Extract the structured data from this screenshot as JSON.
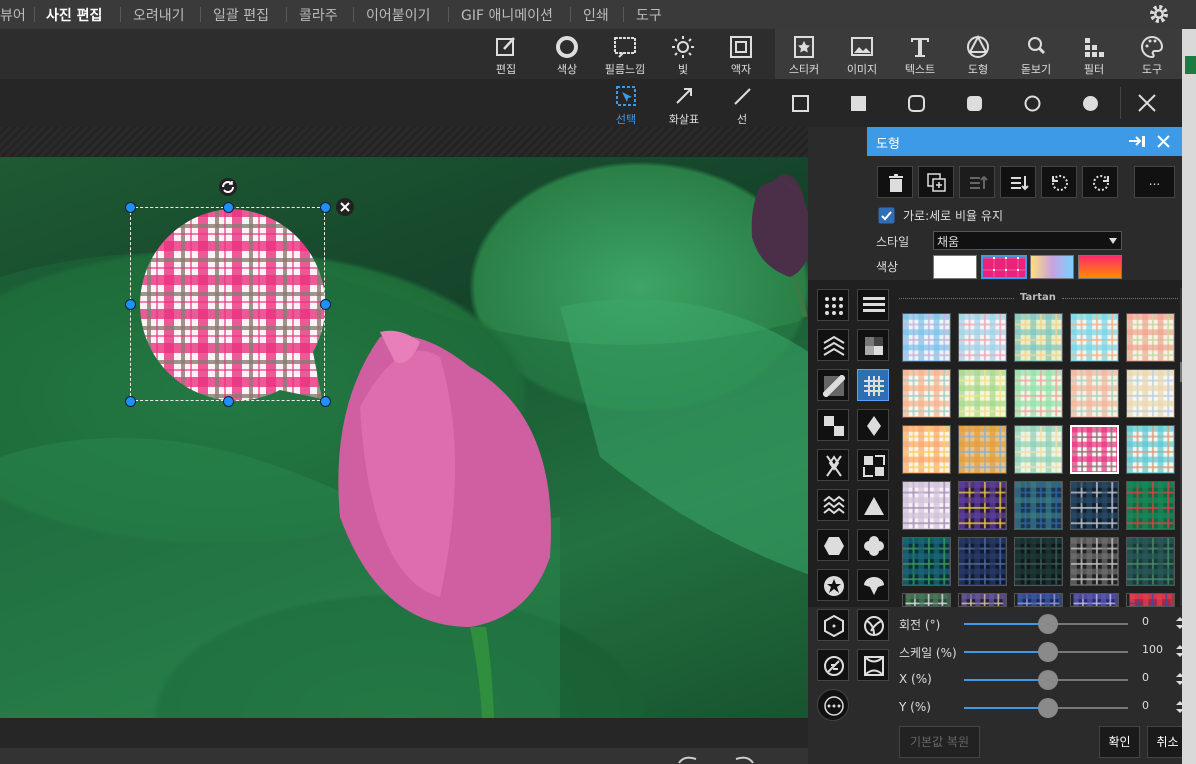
{
  "menu": {
    "items": [
      {
        "label": "뷰어",
        "active": false
      },
      {
        "label": "사진 편집",
        "active": true
      },
      {
        "label": "오려내기",
        "active": false
      },
      {
        "label": "일괄 편집",
        "active": false
      },
      {
        "label": "콜라주",
        "active": false
      },
      {
        "label": "이어붙이기",
        "active": false
      },
      {
        "label": "GIF 애니메이션",
        "active": false
      },
      {
        "label": "인쇄",
        "active": false
      },
      {
        "label": "도구",
        "active": false
      }
    ]
  },
  "toolbar": {
    "left_tools": [
      {
        "label": "편집",
        "icon": "edit-icon"
      },
      {
        "label": "색상",
        "icon": "color-ring-icon"
      },
      {
        "label": "필름느낌",
        "icon": "film-icon"
      },
      {
        "label": "빛",
        "icon": "sun-icon"
      },
      {
        "label": "액자",
        "icon": "frame-icon"
      }
    ],
    "right_tools": [
      {
        "label": "스티커",
        "icon": "sticker-icon"
      },
      {
        "label": "이미지",
        "icon": "image-icon"
      },
      {
        "label": "텍스트",
        "icon": "text-icon"
      },
      {
        "label": "도형",
        "icon": "shape-icon"
      },
      {
        "label": "돋보기",
        "icon": "magnifier-icon"
      },
      {
        "label": "필터",
        "icon": "filter-icon"
      },
      {
        "label": "도구",
        "icon": "palette-icon"
      }
    ]
  },
  "shape_toolbar": {
    "select_label": "선택",
    "arrow_label": "화살표",
    "line_label": "선"
  },
  "panel": {
    "title": "도형",
    "keep_ratio_label": "가로:세로 비율 유지",
    "keep_ratio_checked": true,
    "style_label": "스타일",
    "style_value": "채움",
    "color_label": "색상",
    "gallery_heading": "Tartan",
    "sliders": [
      {
        "label": "회전 (°)",
        "value": "0",
        "fraction": 0.0
      },
      {
        "label": "스케일 (%)",
        "value": "100",
        "fraction": 0.0
      },
      {
        "label": "X (%)",
        "value": "0",
        "fraction": 0.0
      },
      {
        "label": "Y (%)",
        "value": "0",
        "fraction": 0.0
      }
    ],
    "reset_label": "기본값 복원",
    "ok_label": "확인",
    "cancel_label": "취소",
    "more_label": "..."
  },
  "colors": {
    "accent": "#3d9ae6",
    "panel_bg": "#2b2b2b"
  }
}
